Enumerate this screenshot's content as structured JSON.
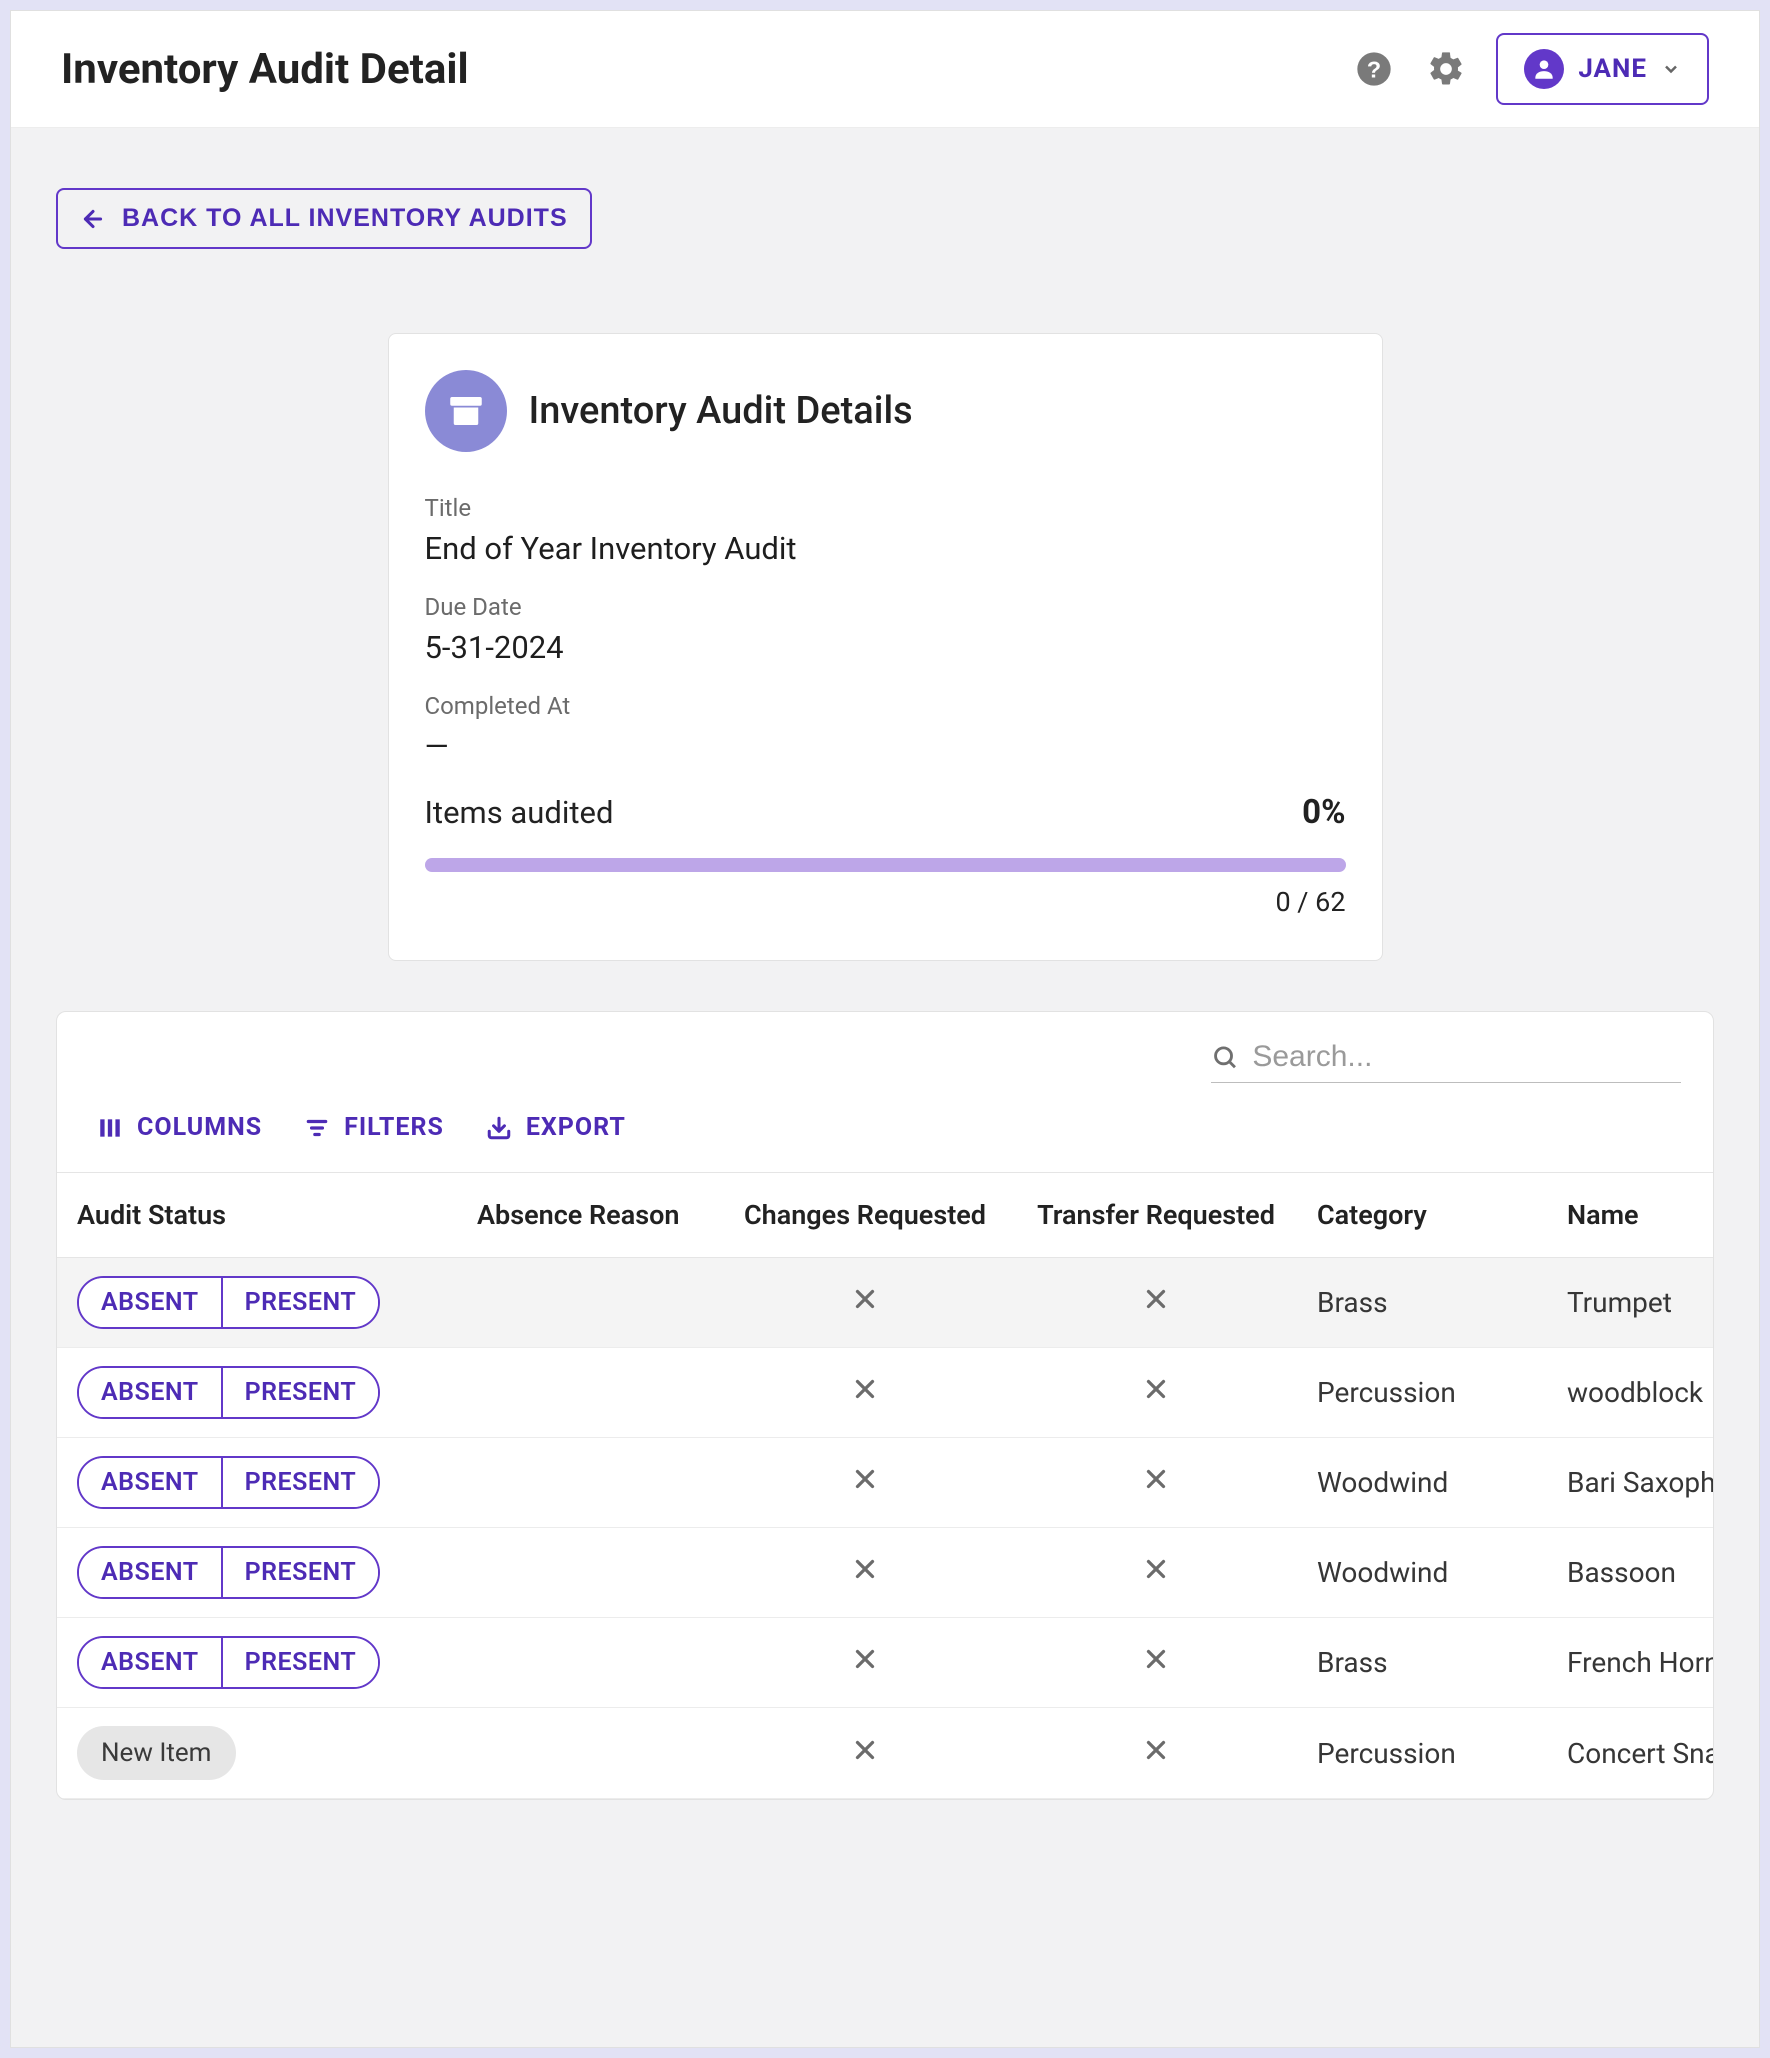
{
  "header": {
    "title": "Inventory Audit Detail",
    "user_name": "JANE"
  },
  "back_button_label": "BACK TO ALL INVENTORY AUDITS",
  "detail_card": {
    "heading": "Inventory Audit Details",
    "title_label": "Title",
    "title_value": "End of Year Inventory Audit",
    "due_label": "Due Date",
    "due_value": "5-31-2024",
    "completed_label": "Completed At",
    "completed_value": "—",
    "progress_label": "Items audited",
    "progress_pct": "0%",
    "progress_count": "0 / 62"
  },
  "table_toolbar": {
    "search_placeholder": "Search...",
    "columns_label": "COLUMNS",
    "filters_label": "FILTERS",
    "export_label": "EXPORT"
  },
  "columns": {
    "status": "Audit Status",
    "reason": "Absence Reason",
    "changes": "Changes Requested",
    "transfer": "Transfer Requested",
    "category": "Category",
    "name": "Name"
  },
  "pill_labels": {
    "absent": "ABSENT",
    "present": "PRESENT"
  },
  "new_item_label": "New Item",
  "rows": [
    {
      "status_type": "choice",
      "reason": "",
      "category": "Brass",
      "name": "Trumpet",
      "selected": true
    },
    {
      "status_type": "choice",
      "reason": "",
      "category": "Percussion",
      "name": "woodblock",
      "selected": false
    },
    {
      "status_type": "choice",
      "reason": "",
      "category": "Woodwind",
      "name": "Bari Saxoph",
      "selected": false
    },
    {
      "status_type": "choice",
      "reason": "",
      "category": "Woodwind",
      "name": "Bassoon",
      "selected": false
    },
    {
      "status_type": "choice",
      "reason": "",
      "category": "Brass",
      "name": "French Horn",
      "selected": false
    },
    {
      "status_type": "newitem",
      "reason": "",
      "category": "Percussion",
      "name": "Concert Sna",
      "selected": false
    }
  ]
}
